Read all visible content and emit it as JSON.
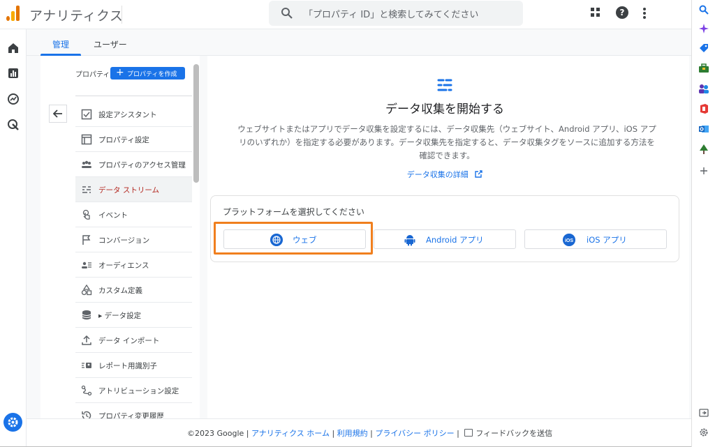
{
  "header": {
    "app_title": "アナリティクス",
    "search_placeholder": "「プロパティ ID」と検索してみてください"
  },
  "tabs": [
    {
      "label": "管理",
      "active": true
    },
    {
      "label": "ユーザー",
      "active": false
    }
  ],
  "panel": {
    "property_label": "プロパティ",
    "create_button": "プロパティを作成",
    "items": [
      {
        "label": "設定アシスタント",
        "icon": "checkbox-icon",
        "active": false
      },
      {
        "label": "プロパティ設定",
        "icon": "layout-icon",
        "active": false
      },
      {
        "label": "プロパティのアクセス管理",
        "icon": "people-icon",
        "active": false
      },
      {
        "label": "データ ストリーム",
        "icon": "streams-icon",
        "active": true
      },
      {
        "label": "イベント",
        "icon": "touch-icon",
        "active": false
      },
      {
        "label": "コンバージョン",
        "icon": "flag-icon",
        "active": false
      },
      {
        "label": "オーディエンス",
        "icon": "audience-icon",
        "active": false
      },
      {
        "label": "カスタム定義",
        "icon": "shapes-icon",
        "active": false
      },
      {
        "label": "▸ データ設定",
        "icon": "database-icon",
        "active": false
      },
      {
        "label": "データ インポート",
        "icon": "upload-icon",
        "active": false
      },
      {
        "label": "レポート用識別子",
        "icon": "identifier-icon",
        "active": false
      },
      {
        "label": "アトリビューション設定",
        "icon": "attribution-icon",
        "active": false
      },
      {
        "label": "プロパティ変更履歴",
        "icon": "history-icon",
        "active": false
      }
    ]
  },
  "main": {
    "title": "データ収集を開始する",
    "description": "ウェブサイトまたはアプリでデータ収集を設定するには、データ収集先（ウェブサイト、Android アプリ、iOS アプリのいずれか）を指定する必要があります。データ収集先を指定すると、データ収集タグをソースに追加する方法を確認できます。",
    "detail_link": "データ収集の詳細",
    "platform_title": "プラットフォームを選択してください",
    "platforms": [
      {
        "label": "ウェブ",
        "icon": "globe-icon"
      },
      {
        "label": "Android アプリ",
        "icon": "android-icon"
      },
      {
        "label": "iOS アプリ",
        "icon": "ios-icon"
      }
    ]
  },
  "footer": {
    "copyright": "©2023 Google",
    "sep": " | ",
    "links": [
      "アナリティクス ホーム",
      "利用規約",
      "プライバシー ポリシー"
    ],
    "feedback": "フィードバックを送信"
  },
  "colors": {
    "accent": "#1a73e8",
    "active_item": "#b3261e",
    "highlight": "#f07f1e"
  }
}
